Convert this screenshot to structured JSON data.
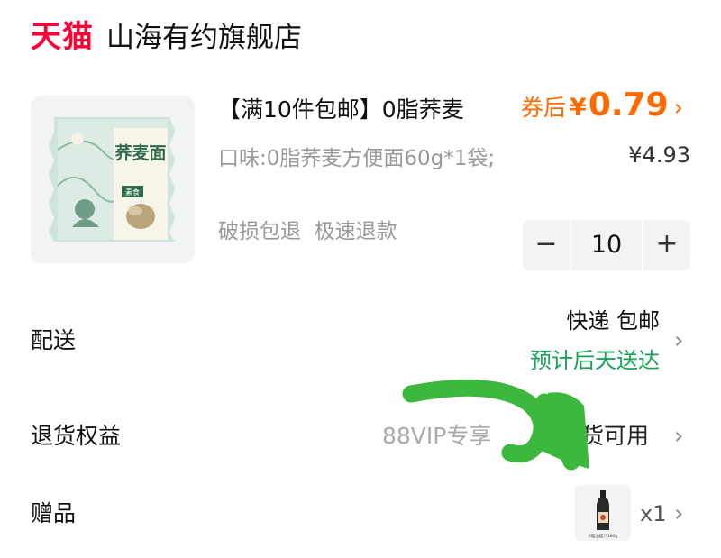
{
  "header": {
    "platform": "天猫",
    "store_name": "山海有约旗舰店"
  },
  "product": {
    "title": "【满10件包邮】0脂荞麦",
    "coupon_label": "券后",
    "currency": "¥",
    "price_after_coupon": "0.79",
    "original_price": "¥4.93",
    "spec": "口味:0脂荞麦方便面60g*1袋;",
    "services": "破损包退  极速退款",
    "quantity": "10",
    "package_text": "荞麦面",
    "package_tag": "素食"
  },
  "stepper": {
    "minus": "−",
    "plus": "+"
  },
  "delivery": {
    "label": "配送",
    "method": "快递 包邮",
    "eta": "预计后天送达"
  },
  "returns": {
    "label": "退货权益",
    "vip": "88VIP专享",
    "available": "退货可用"
  },
  "gift": {
    "label": "赠品",
    "quantity": "x1",
    "bottle_text": "0脂油醋汁180g"
  },
  "icons": {
    "chevron": "chevron-right-icon"
  },
  "colors": {
    "brand": "#ff0036",
    "price": "#ff6a00",
    "delivery_eta": "#19a35a",
    "annotation_arrow": "#3cb93c"
  }
}
